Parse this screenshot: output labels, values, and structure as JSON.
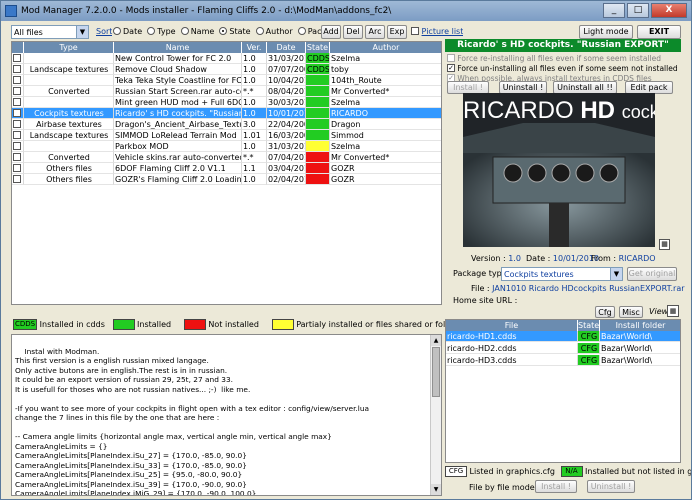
{
  "window": {
    "title": "Mod Manager 7.2.0.0 - Mods installer - Flaming Cliffs 2.0 - d:\\ModMan\\addons_fc2\\",
    "minimize": "_",
    "maximize": "□",
    "close": "X"
  },
  "toolbar": {
    "filter_value": "All files",
    "sort_label": "Sort",
    "sort_options": [
      "Date",
      "Type",
      "Name",
      "State",
      "Author",
      "Package"
    ],
    "sort_selected": "State",
    "add": "Add",
    "del": "Del",
    "arc": "Arc",
    "exp": "Exp",
    "picture_list": "Picture list",
    "light_mode": "Light mode",
    "exit": "EXIT"
  },
  "mods_table": {
    "columns": [
      "Type",
      "Name",
      "Ver.",
      "Date",
      "State",
      "Author"
    ],
    "rows": [
      {
        "type": "",
        "name": "New Control Tower for FC 2.0",
        "ver": "1.0",
        "date": "31/03/2010",
        "state": "CDDS",
        "state_color": "#22cc22",
        "author": "Szelma",
        "selected": false
      },
      {
        "type": "Landscape textures",
        "name": "Remove Cloud Shadow",
        "ver": "1.0",
        "date": "07/07/2009",
        "state": "CDDS",
        "state_color": "#22cc22",
        "author": "toby",
        "selected": false
      },
      {
        "type": "",
        "name": "Teka Teka Style Coastline for FC 2.0",
        "ver": "1.0",
        "date": "10/04/2010",
        "state": "",
        "state_color": "#22cc22",
        "author": "104th_Route",
        "selected": false
      },
      {
        "type": "Converted",
        "name": "Russian Start Screen.rar auto-converted",
        "ver": "*.*",
        "date": "08/04/2010",
        "state": "",
        "state_color": "#22cc22",
        "author": "Mr Converted*",
        "selected": false
      },
      {
        "type": "",
        "name": "Mint green HUD mod + Full 6DOF Cockpi",
        "ver": "1.0",
        "date": "30/03/2010",
        "state": "",
        "state_color": "#22cc22",
        "author": "Szelma",
        "selected": false
      },
      {
        "type": "Cockpits textures",
        "name": "Ricardo' s HD cockpits. \"Russian",
        "ver": "1.0",
        "date": "10/01/2010",
        "state": "",
        "state_color": "#22cc22",
        "author": "RICARDO",
        "selected": true
      },
      {
        "type": "Airbase textures",
        "name": "Dragon's_Ancient_Airbase_Texture_Se",
        "ver": "3.0",
        "date": "22/04/2009",
        "state": "",
        "state_color": "#22cc22",
        "author": "Dragon",
        "selected": false
      },
      {
        "type": "Landscape textures",
        "name": "SIMMOD LoRelead Terrain Mod",
        "ver": "1.01",
        "date": "16/03/2009",
        "state": "",
        "state_color": "#22cc22",
        "author": "Simmod",
        "selected": false
      },
      {
        "type": "",
        "name": "Parkbox MOD",
        "ver": "1.0",
        "date": "31/03/2010",
        "state": "",
        "state_color": "#ffff33",
        "author": "Szelma",
        "selected": false
      },
      {
        "type": "Converted",
        "name": "Vehicle skins.rar auto-converted by Mo",
        "ver": "*.*",
        "date": "07/04/2010",
        "state": "",
        "state_color": "#ee1111",
        "author": "Mr Converted*",
        "selected": false
      },
      {
        "type": "Others files",
        "name": "6DOF Flaming Cliff 2.0 V1.1",
        "ver": "1.1",
        "date": "03/04/2010",
        "state": "",
        "state_color": "#ee1111",
        "author": "GOZR",
        "selected": false
      },
      {
        "type": "Others files",
        "name": "GOZR's Flaming Cliff 2.0 Loading pictu",
        "ver": "1.0",
        "date": "02/04/2010",
        "state": "",
        "state_color": "#ee1111",
        "author": "GOZR",
        "selected": false
      }
    ]
  },
  "legend": {
    "cdds_tag": "CDDS",
    "cdds_label": "Installed in cdds",
    "installed_label": "Installed",
    "not_installed_label": "Not installed",
    "partial_label": "Partialy installed or files shared or folder not removed",
    "colors": {
      "green": "#22cc22",
      "red": "#ee1111",
      "yellow": "#ffff33"
    }
  },
  "description_text": "Instal with Modman.\nThis first version is a english russian mixed langage.\nOnly active butons are in english.The rest is in in russian.\nIt could be an export version of russian 29, 25t, 27 and 33.\nIt is usefull for thoses who are not russian natives... ;-)  like me.\n\n-If you want to see more of your cockpits in flight open with a tex editor : config/view/server.lua\nchange the 7 lines in this file by the one that are here :\n\n-- Camera angle limits {horizontal angle max, vertical angle min, vertical angle max}\nCameraAngleLimits = {}\nCameraAngleLimits[PlaneIndex.iSu_27] = {170.0, -85.0, 90.0}\nCameraAngleLimits[PlaneIndex.iSu_33] = {170.0, -85.0, 90.0}\nCameraAngleLimits[PlaneIndex.iSu_25] = {95.0, -80.0, 90.0}\nCameraAngleLimits[PlaneIndex.iSu_39] = {170.0, -90.0, 90.0}\nCameraAngleLimits[PlaneIndex.iMiG_29] = {170.0, -90.0, 100.0}",
  "details": {
    "title": "Ricardo' s HD cockpits. \"Russian EXPORT\"",
    "opt_force_reinstall": "Force re-installing all files even if some seem installed",
    "opt_force_uninstall": "Force un-installing all files even if some seem not installed",
    "opt_cdds": "When possible, always install textures in CDDS files",
    "install": "Install !",
    "uninstall": "Uninstall !",
    "uninstall_all": "Uninstall all !!",
    "edit_pack": "Edit pack",
    "preview_text_a": "RICARDO",
    "preview_text_b": "HD",
    "preview_text_c": "cockpits",
    "version_label": "Version :",
    "version_value": "1.0",
    "date_label": "Date :",
    "date_value": "10/01/2010",
    "from_label": "From :",
    "from_value": "RICARDO",
    "package_type_label": "Package type :",
    "package_type_value": "Cockpits textures",
    "get_original": "Get original",
    "file_label": "File :",
    "file_value": "JAN1010 Ricardo HDcockpits RussianEXPORT.rar",
    "home_site_label": "Home site URL :",
    "cfg_btn": "Cfg",
    "misc_btn": "Misc",
    "view_label": "View"
  },
  "files_table": {
    "columns": [
      "File",
      "State",
      "Install folder"
    ],
    "rows": [
      {
        "file": "ricardo-HD1.cdds",
        "state": "CFG",
        "folder": "Bazar\\World\\",
        "selected": true
      },
      {
        "file": "ricardo-HD2.cdds",
        "state": "CFG",
        "folder": "Bazar\\World\\",
        "selected": false
      },
      {
        "file": "ricardo-HD3.cdds",
        "state": "CFG",
        "folder": "Bazar\\World\\",
        "selected": false
      }
    ]
  },
  "bottom": {
    "cfg_tag": "CFG",
    "cfg_label": "Listed in graphics.cfg",
    "na_tag": "N/A",
    "na_label": "Installed but not listed in graphics.cfg",
    "file_by_file": "File by file mode",
    "install": "Install !",
    "uninstall": "Uninstall !"
  }
}
